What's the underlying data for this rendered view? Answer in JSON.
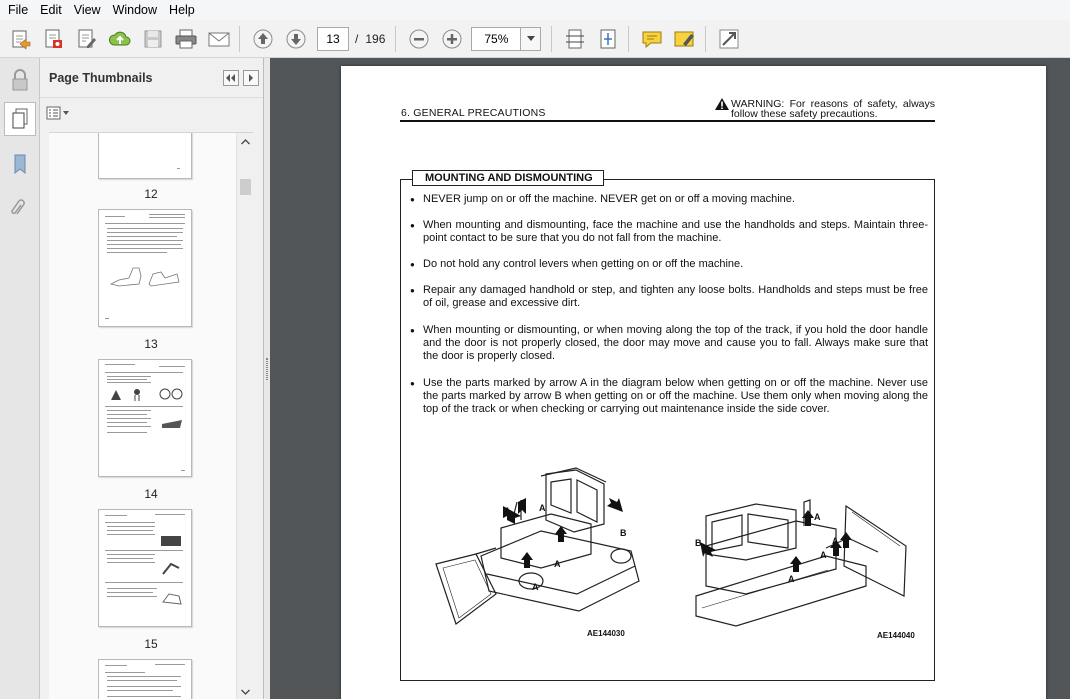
{
  "menu": [
    "File",
    "Edit",
    "View",
    "Window",
    "Help"
  ],
  "toolbar": {
    "current_page": "13",
    "page_sep": "/",
    "total_pages": "196",
    "zoom": "75%"
  },
  "thumbnails": {
    "title": "Page Thumbnails",
    "pages": [
      "12",
      "13",
      "14",
      "15"
    ]
  },
  "document": {
    "header_left": "6. GENERAL PRECAUTIONS",
    "header_right": "WARNING: For reasons of safety, always follow these safety precautions.",
    "box_title": "MOUNTING AND DISMOUNTING",
    "bullets": [
      "NEVER jump on or off the machine. NEVER get on or off a moving machine.",
      "When mounting and dismounting, face the machine and use the handholds and steps. Maintain three-point contact to be sure that you do not fall from the machine.",
      "Do not hold any control levers when getting on or off the machine.",
      "Repair any damaged handhold or step, and tighten any loose bolts. Handholds and steps must be free of oil, grease and excessive dirt.",
      "When mounting or dismounting, or when moving along the top of the track, if you hold the door handle and the door is not properly closed, the door may move and cause you to fall. Always make sure that the door is properly closed.",
      "Use the parts marked by arrow A in the diagram below when getting on or off the machine. Never use the parts marked by arrow B when getting on or off the machine. Use them only when moving along the top of the track or when checking or carrying out maintenance inside the side cover."
    ],
    "figure_codes": [
      "AE144030",
      "AE144040"
    ],
    "arrow_a": "A",
    "arrow_b": "B"
  }
}
